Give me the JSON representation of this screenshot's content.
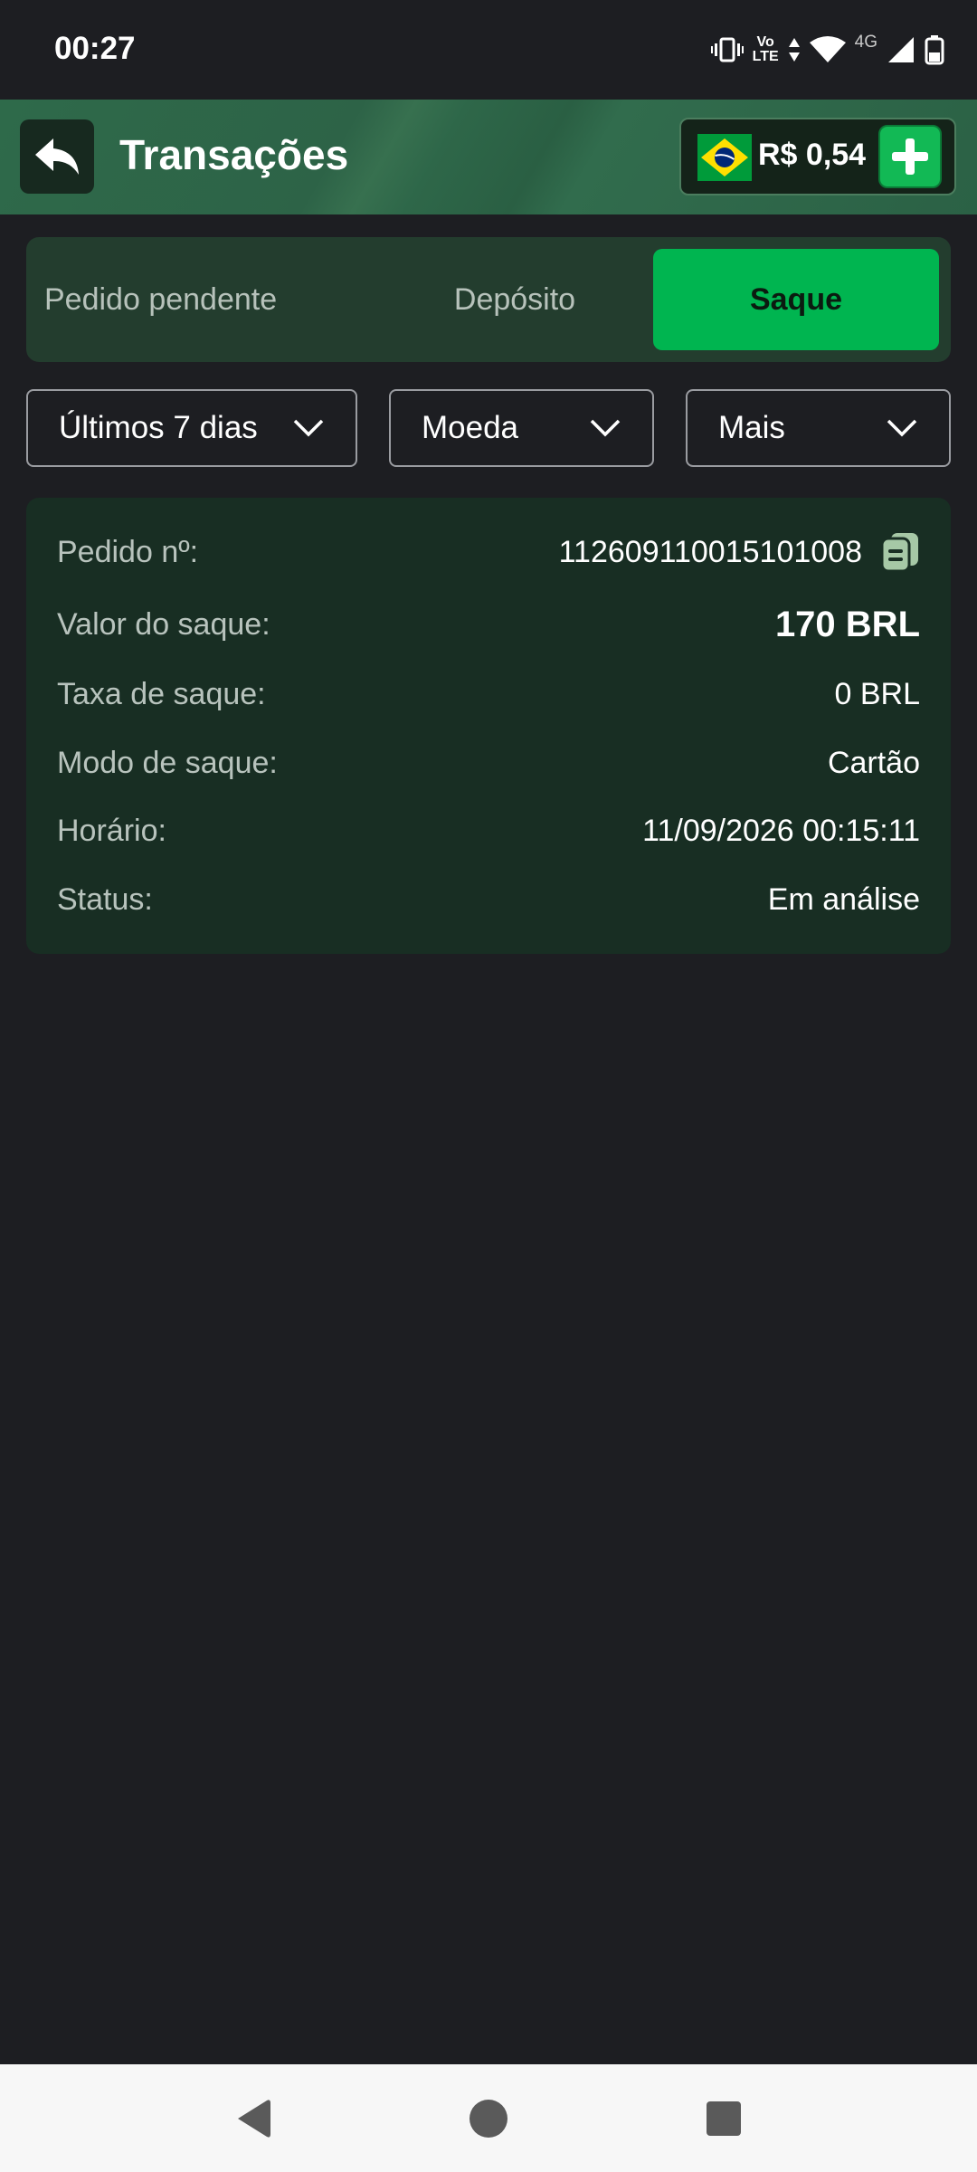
{
  "status_bar": {
    "time": "00:27",
    "lte_top": "Vo",
    "lte_bottom": "LTE",
    "network": "4G"
  },
  "header": {
    "title": "Transações",
    "balance": "R$ 0,54",
    "flag_icon": "brazil-flag-icon"
  },
  "tabs": [
    {
      "label": "Pedido pendente",
      "active": false
    },
    {
      "label": "Depósito",
      "active": false
    },
    {
      "label": "Saque",
      "active": true
    }
  ],
  "filters": [
    {
      "label": "Últimos 7 dias"
    },
    {
      "label": "Moeda"
    },
    {
      "label": "Mais"
    }
  ],
  "transaction": {
    "order_label": "Pedido nº:",
    "order_value": "112609110015101008",
    "amount_label": "Valor do saque:",
    "amount_value": "170 BRL",
    "fee_label": "Taxa de saque:",
    "fee_value": "0 BRL",
    "mode_label": "Modo de saque:",
    "mode_value": "Cartão",
    "time_label": "Horário:",
    "time_value": "11/09/2026 00:15:11",
    "status_label": "Status:",
    "status_value": "Em análise"
  },
  "colors": {
    "accent": "#00b550",
    "header_bg": "#2e6749",
    "card_bg": "#182e23",
    "page_bg": "#1d1e22"
  }
}
